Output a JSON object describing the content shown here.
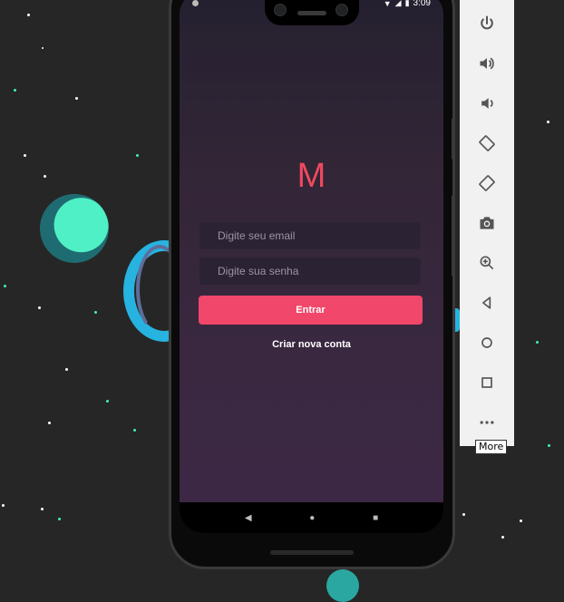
{
  "status_bar": {
    "time": "3:09",
    "wifi_icon": "wifi-icon",
    "signal_icon": "signal-icon",
    "battery_icon": "battery-icon"
  },
  "app": {
    "logo": "M",
    "email_placeholder": "Digite seu email",
    "password_placeholder": "Digite sua senha",
    "login_button": "Entrar",
    "create_account_link": "Criar nova conta"
  },
  "colors": {
    "accent": "#f0476a",
    "logo": "#f0485f",
    "background_top": "#24202f",
    "background_bottom": "#3d2845",
    "input_bg": "#2b2333"
  },
  "navigation": {
    "back_icon": "back-triangle-icon",
    "home_icon": "home-circle-icon",
    "recents_icon": "recents-square-icon"
  },
  "emulator_panel": {
    "items": [
      "power-icon",
      "volume-up-icon",
      "volume-down-icon",
      "rotate-left-icon",
      "rotate-right-icon",
      "camera-icon",
      "zoom-icon",
      "back-icon",
      "home-icon",
      "overview-icon",
      "more-icon"
    ],
    "tooltip": "More"
  }
}
